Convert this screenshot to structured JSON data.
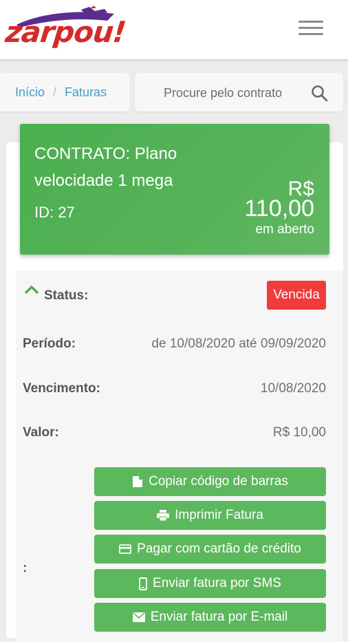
{
  "header": {
    "logo_text": "zarpou!",
    "menu_icon": "hamburger-menu-icon"
  },
  "breadcrumb": {
    "items": [
      "Início",
      "Faturas"
    ],
    "separator": "/"
  },
  "search": {
    "placeholder": "Procure pelo contrato",
    "icon": "search-icon"
  },
  "contract": {
    "title": "CONTRATO: Plano velocidade 1 mega",
    "id": "ID: 27",
    "currency": "R$",
    "amount": "110,00",
    "status": "em aberto"
  },
  "details": {
    "status_label": "Status:",
    "status_value": "Vencida",
    "period_label": "Período:",
    "period_value": "de 10/08/2020 até 09/09/2020",
    "due_label": "Vencimento:",
    "due_value": "10/08/2020",
    "amount_label": "Valor:",
    "amount_value": "R$ 10,00",
    "actions_label": ":"
  },
  "actions": [
    {
      "label": "Copiar código de barras",
      "icon": "document-icon"
    },
    {
      "label": "Imprimir Fatura",
      "icon": "printer-icon"
    },
    {
      "label": "Pagar com cartão de crédito",
      "icon": "credit-card-icon"
    },
    {
      "label": "Enviar fatura por SMS",
      "icon": "mobile-phone-icon"
    },
    {
      "label": "Enviar fatura por E-mail",
      "icon": "envelope-icon"
    }
  ],
  "colors": {
    "brand_red": "#d42a2a",
    "brand_purple": "#5b2d8e",
    "link_blue": "#3aa0c8",
    "success_green": "#5cb85c",
    "card_green": "#4caf50",
    "danger_red": "#ef3b3b"
  }
}
